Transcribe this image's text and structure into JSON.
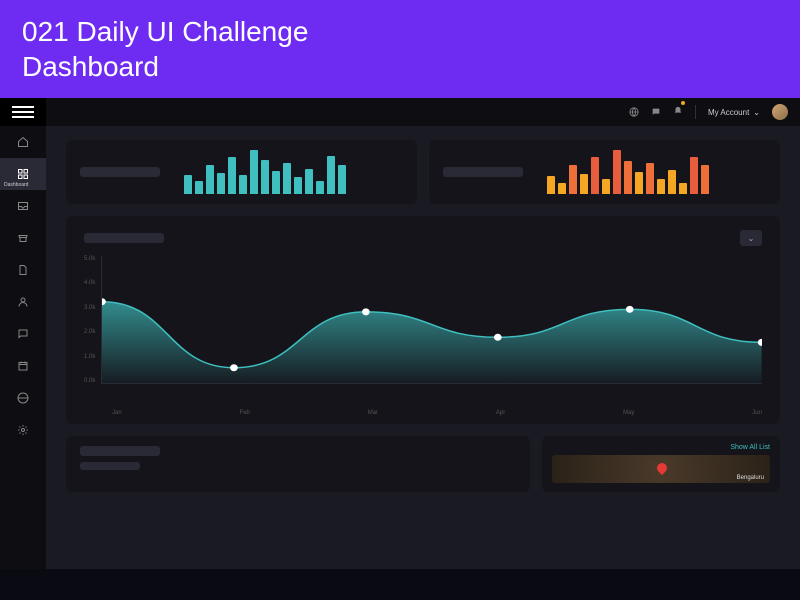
{
  "banner": {
    "line1": "021 Daily UI Challenge",
    "line2": "Dashboard"
  },
  "topbar": {
    "account_label": "My Account"
  },
  "sidebar": {
    "active_index": 1,
    "items": [
      {
        "name": "home",
        "label": ""
      },
      {
        "name": "dashboard",
        "label": "Dashboard"
      },
      {
        "name": "inbox",
        "label": ""
      },
      {
        "name": "store",
        "label": ""
      },
      {
        "name": "files",
        "label": ""
      },
      {
        "name": "users",
        "label": ""
      },
      {
        "name": "chat",
        "label": ""
      },
      {
        "name": "calendar",
        "label": ""
      },
      {
        "name": "globe",
        "label": ""
      },
      {
        "name": "settings",
        "label": ""
      }
    ]
  },
  "map": {
    "link_label": "Show All List",
    "city": "Bengaluru"
  },
  "colors": {
    "teal": "#3fbfbf",
    "orange": "#f5a623",
    "red": "#e85d3d"
  },
  "chart_data": [
    {
      "type": "bar",
      "id": "mini_teal",
      "values": [
        18,
        12,
        28,
        20,
        35,
        18,
        42,
        32,
        22,
        30,
        16,
        24,
        12,
        36,
        28
      ],
      "color_single": "#3fbfbf"
    },
    {
      "type": "bar",
      "id": "mini_warm",
      "values": [
        16,
        10,
        26,
        18,
        34,
        14,
        40,
        30,
        20,
        28,
        14,
        22,
        10,
        34,
        26
      ],
      "colors": [
        "#f5a623",
        "#f5a623",
        "#ef6f3a",
        "#f5a623",
        "#e85d3d",
        "#f5a623",
        "#e85d3d",
        "#ef6f3a",
        "#f5a623",
        "#ef6f3a",
        "#f5a623",
        "#f5a623",
        "#f5a623",
        "#e85d3d",
        "#ef6f3a"
      ]
    },
    {
      "type": "area",
      "id": "main_area",
      "title": "",
      "xlabel": "",
      "ylabel": "",
      "ylim": [
        0,
        5
      ],
      "y_ticks": [
        "5.0k",
        "4.0k",
        "3.0k",
        "2.0k",
        "1.0k",
        "0.0k"
      ],
      "categories": [
        "Jan",
        "Feb",
        "Mar",
        "Apr",
        "May",
        "Jun"
      ],
      "values": [
        3.2,
        0.6,
        2.8,
        1.8,
        2.9,
        1.6
      ],
      "color": "#3fbfbf"
    }
  ]
}
